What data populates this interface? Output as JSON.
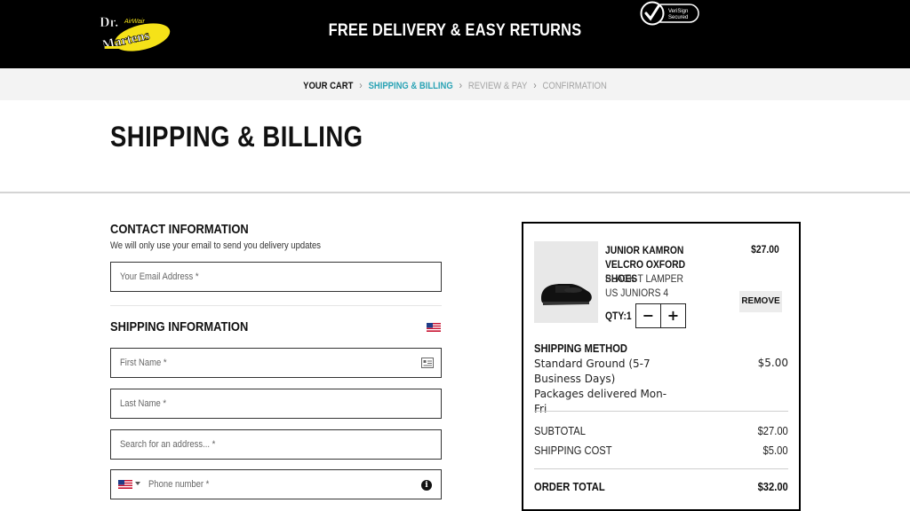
{
  "header": {
    "logo_text": "Dr. Martens AirWair",
    "promo": "FREE DELIVERY & EASY RETURNS",
    "security_badge": "VeriSign Secured",
    "logo_icon": "dr-martens-logo",
    "badge_icon": "verisign-check-icon"
  },
  "breadcrumb": [
    {
      "label": "YOUR CART",
      "state": "done"
    },
    {
      "label": "SHIPPING & BILLING",
      "state": "active"
    },
    {
      "label": "REVIEW & PAY",
      "state": "todo"
    },
    {
      "label": "CONFIRMATION",
      "state": "todo"
    }
  ],
  "page": {
    "title": "SHIPPING & BILLING"
  },
  "contact": {
    "heading": "CONTACT INFORMATION",
    "subtext": "We will only use your email to send you delivery updates",
    "email_placeholder": "Your Email Address *"
  },
  "shipping_info": {
    "heading": "SHIPPING INFORMATION",
    "country_flag": "us-flag-icon",
    "first_name_placeholder": "First Name *",
    "last_name_placeholder": "Last Name *",
    "address_placeholder": "Search for an address... *",
    "phone_placeholder": "Phone number *"
  },
  "summary": {
    "product": {
      "name": "JUNIOR KAMRON VELCRO OXFORD SHOES",
      "color": "BLACK T LAMPER",
      "size": "US JUNIORS 4",
      "price": "$27.00",
      "qty_label": "QTY:1",
      "remove_label": "REMOVE",
      "minus_label": "−",
      "plus_label": "+"
    },
    "shipping_method": {
      "heading": "SHIPPING METHOD",
      "description": "Standard Ground (5-7 Business Days)",
      "note": "Packages delivered Mon-Fri",
      "price": "$5.00"
    },
    "subtotal_label": "SUBTOTAL",
    "subtotal_value": "$27.00",
    "shipping_cost_label": "SHIPPING COST",
    "shipping_cost_value": "$5.00",
    "order_total_label": "ORDER TOTAL",
    "order_total_value": "$32.00"
  },
  "colors": {
    "header_bg": "#000000",
    "accent_teal": "#2aa3b5",
    "logo_yellow": "#f5e218"
  }
}
